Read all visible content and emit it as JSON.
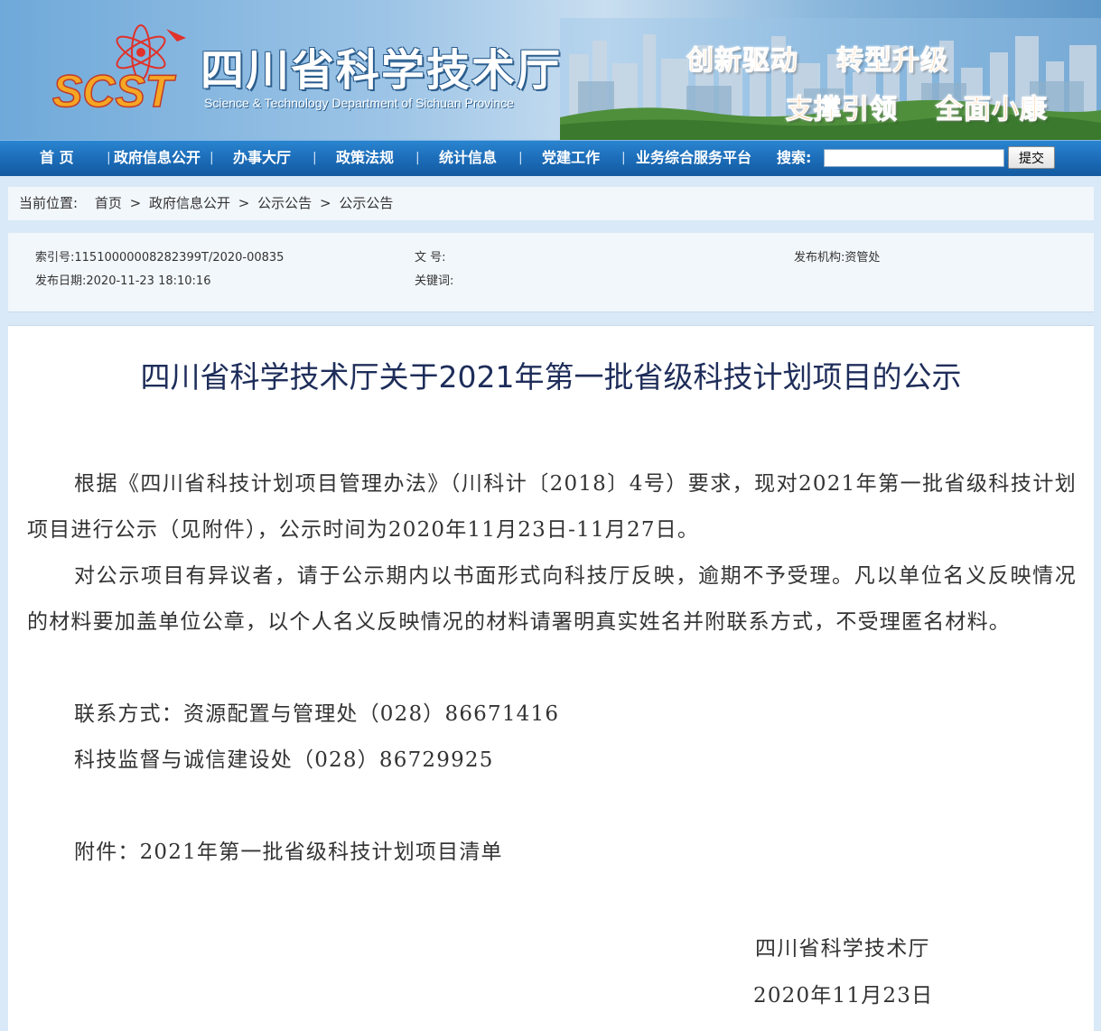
{
  "header": {
    "logo_text": "SCST",
    "title_cn": "四川省科学技术厅",
    "title_en": "Science & Technology Department of Sichuan Province",
    "slogans": [
      "创新驱动",
      "转型升级",
      "支撑引领",
      "全面小康"
    ]
  },
  "nav": {
    "items": [
      "首 页",
      "政府信息公开",
      "办事大厅",
      "政策法规",
      "统计信息",
      "党建工作",
      "业务综合服务平台"
    ],
    "separator": "|",
    "search_label": "搜索:",
    "search_value": "",
    "submit_label": "提交"
  },
  "breadcrumb": {
    "label": "当前位置:",
    "items": [
      "首页",
      "政府信息公开",
      "公示公告",
      "公示公告"
    ],
    "separator": ">"
  },
  "meta": {
    "index_label": "索引号:",
    "index_value": "11510000008282399T/2020-00835",
    "docno_label": "文 号:",
    "docno_value": "",
    "publisher_label": "发布机构:",
    "publisher_value": "资管处",
    "date_label": "发布日期:",
    "date_value": "2020-11-23 18:10:16",
    "keywords_label": "关键词:",
    "keywords_value": ""
  },
  "article": {
    "title": "四川省科学技术厅关于2021年第一批省级科技计划项目的公示",
    "paragraphs": [
      "根据《四川省科技计划项目管理办法》（川科计〔2018〕4号）要求，现对2021年第一批省级科技计划项目进行公示（见附件），公示时间为2020年11月23日-11月27日。",
      "对公示项目有异议者，请于公示期内以书面形式向科技厅反映，逾期不予受理。凡以单位名义反映情况的材料要加盖单位公章，以个人名义反映情况的材料请署明真实姓名并附联系方式，不受理匿名材料。",
      "联系方式：资源配置与管理处（028）86671416",
      "科技监督与诚信建设处（028）86729925"
    ],
    "attachment": "附件：2021年第一批省级科技计划项目清单",
    "signature_org": "四川省科学技术厅",
    "signature_date": "2020年11月23日"
  },
  "colors": {
    "nav_bg": "#1b6bb7",
    "title_text": "#1e2d5a",
    "slogan": "#ff8a1e",
    "page_bg": "#d9e9f7"
  }
}
